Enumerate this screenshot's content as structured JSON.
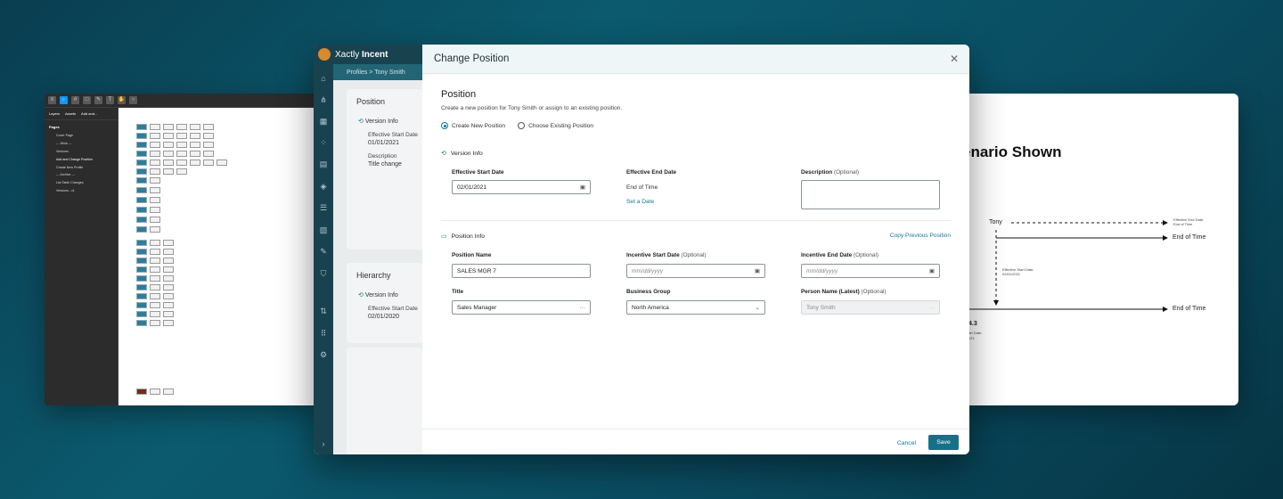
{
  "figma": {
    "tabs": [
      "Layers",
      "Assets",
      "Add and..."
    ],
    "pages_title": "Pages",
    "pages": [
      "Cover Page",
      "--- Work ---",
      "Versions",
      "Add and Change Position",
      "Create New Profile",
      "--- Archive ---",
      "List Table Changes",
      "Versions - v1"
    ]
  },
  "scenario": {
    "title": "enario Shown",
    "tony": "Tony",
    "end_of_time_1": "End of Time",
    "end_of_time_2": "End of Time",
    "eff_end_label": "Effective End Date:",
    "eff_end_value": "End of Time",
    "eff_start_label": "Effective Start Date:",
    "eff_start_value": "02/01/2021",
    "frag_1": "4.3",
    "frag_2": "art Date:",
    "frag_3": "021"
  },
  "app": {
    "brand_light": "Xactly ",
    "brand_bold": "Incent",
    "breadcrumb": "Profiles  >  Tony Smith",
    "bg_position": {
      "title": "Position",
      "version_info": "Version Info",
      "eff_start_label": "Effective Start Date",
      "eff_start_value": "01/01/2021",
      "desc_label": "Description",
      "desc_value": "Title change"
    },
    "bg_hierarchy": {
      "title": "Hierarchy",
      "version_info": "Version Info",
      "eff_start_label": "Effective Start Date",
      "eff_start_value": "02/01/2020"
    }
  },
  "modal": {
    "title": "Change Position",
    "section_title": "Position",
    "section_desc": "Create a new position for Tony Smith or assign to an existing position.",
    "radio_new": "Create New Position",
    "radio_existing": "Choose Existing Position",
    "version_info": "Version Info",
    "eff_start_label": "Effective Start Date",
    "eff_start_value": "02/01/2021",
    "eff_end_label": "Effective End Date",
    "eff_end_value": "End of Time",
    "set_date": "Set a Date",
    "description_label": "Description",
    "optional": "(Optional)",
    "position_info": "Position Info",
    "copy_previous": "Copy Previous Position",
    "position_name_label": "Position Name",
    "position_name_value": "SALES MGR 7",
    "inc_start_label": "Incentive Start Date",
    "inc_start_placeholder": "mm/dd/yyyy",
    "inc_end_label": "Incentive End Date",
    "inc_end_placeholder": "mm/dd/yyyy",
    "title_label": "Title",
    "title_value": "Sales Manager",
    "business_group_label": "Business Group",
    "business_group_value": "North America",
    "person_name_label": "Person Name (Latest)",
    "person_name_value": "Tony Smith",
    "cancel": "Cancel",
    "save": "Save"
  },
  "colors": {
    "accent": "#0f7c92",
    "rail": "#19424f",
    "save_button": "#17708a"
  }
}
